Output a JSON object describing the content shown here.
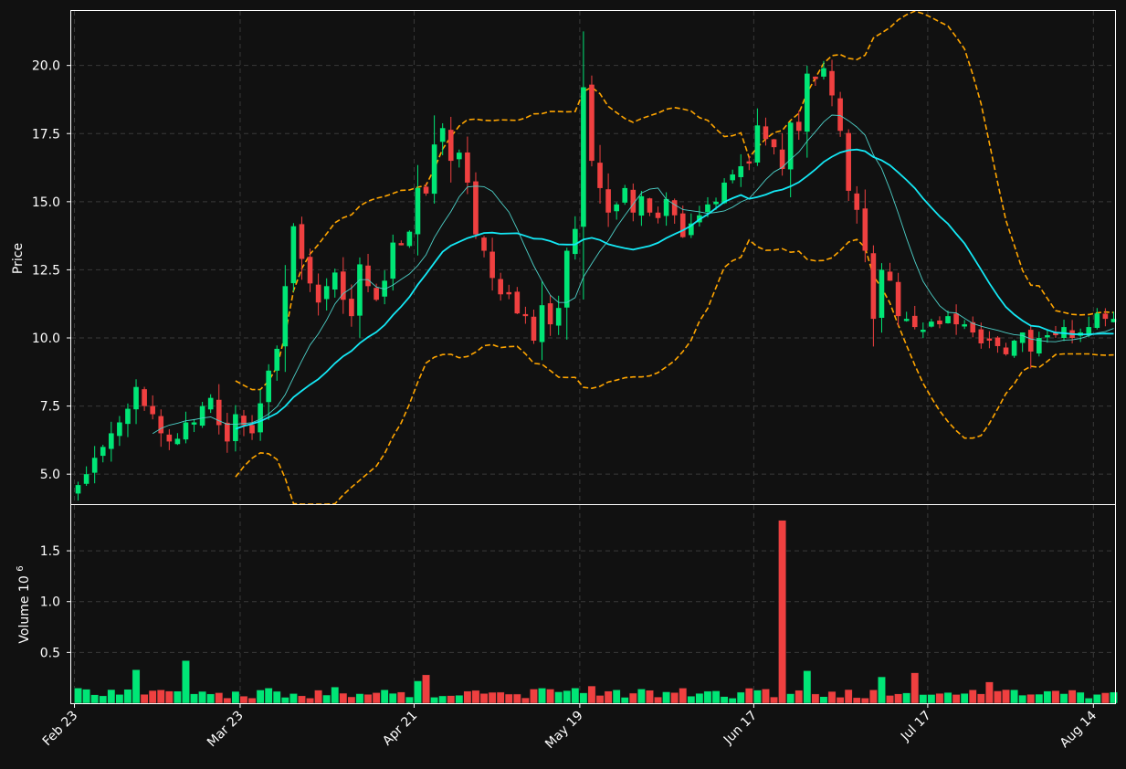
{
  "chart_data": {
    "type": "candlestick",
    "price_panel": {
      "ylabel": "Price",
      "ylim": [
        3.9,
        22.0
      ],
      "yticks": [
        "5.0",
        "7.5",
        "10.0",
        "12.5",
        "15.0",
        "17.5",
        "20.0"
      ],
      "grid": true
    },
    "volume_panel": {
      "ylabel": "Volume",
      "ylabel_exponent": "10",
      "ylabel_exponent_power": "6",
      "ylim": [
        0,
        1.95
      ],
      "yticks": [
        "0.5",
        "1.0",
        "1.5"
      ],
      "grid": true
    },
    "xticks": [
      "Feb 23",
      "Mar 23",
      "Apr 21",
      "May 19",
      "Jun 17",
      "Jul 17",
      "Aug 14"
    ],
    "colors": {
      "background": "#111111",
      "up": "#00e676",
      "down": "#ef4040",
      "grid": "#3a3a3a",
      "frame": "#ffffff",
      "text": "#ffffff",
      "ma_fast": "#4dd0c8",
      "ma_slow": "#14e8f5",
      "bands": "#ffa500"
    },
    "close_path": [
      4.6,
      5.0,
      5.6,
      6.0,
      6.5,
      6.9,
      7.4,
      8.2,
      7.5,
      7.2,
      6.5,
      6.2,
      6.3,
      6.9,
      6.9,
      7.5,
      7.8,
      6.8,
      6.2,
      7.2,
      6.8,
      6.5,
      7.6,
      8.8,
      9.6,
      11.9,
      14.1,
      12.9,
      12.0,
      11.3,
      11.9,
      12.4,
      11.4,
      10.8,
      12.7,
      11.9,
      11.4,
      12.1,
      13.5,
      13.4,
      13.9,
      15.5,
      15.3,
      17.1,
      17.7,
      16.5,
      16.8,
      15.7,
      13.8,
      13.2,
      12.2,
      11.6,
      11.6,
      10.9,
      10.8,
      9.9,
      11.2,
      10.5,
      11.1,
      13.2,
      14.0,
      19.2,
      16.5,
      15.5,
      14.6,
      14.9,
      15.5,
      14.6,
      15.2,
      14.6,
      14.4,
      15.1,
      14.5,
      13.7,
      14.2,
      14.5,
      14.9,
      15.0,
      15.7,
      16.0,
      16.3,
      16.4,
      17.8,
      17.3,
      17.0,
      16.2,
      17.9,
      17.6,
      19.7,
      19.5,
      19.9,
      18.9,
      17.6,
      15.4,
      14.7,
      13.2,
      10.7,
      12.5,
      12.1,
      10.8,
      10.7,
      10.4,
      10.3,
      10.6,
      10.5,
      10.8,
      10.5,
      10.5,
      10.2,
      9.8,
      9.9,
      9.7,
      9.4,
      9.9,
      10.2,
      9.5,
      10.0,
      10.1,
      10.1,
      10.4,
      10.0,
      10.2,
      10.4,
      10.9,
      10.7,
      10.7
    ]
  }
}
